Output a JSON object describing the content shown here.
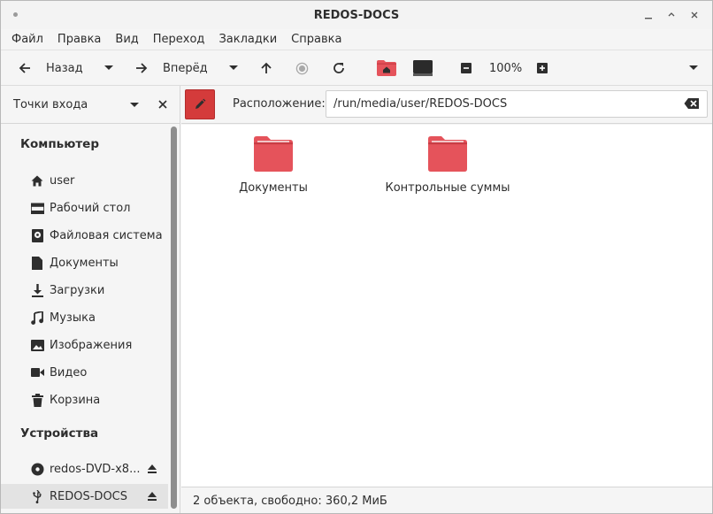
{
  "window": {
    "title": "REDOS-DOCS"
  },
  "menu": [
    "Файл",
    "Правка",
    "Вид",
    "Переход",
    "Закладки",
    "Справка"
  ],
  "toolbar": {
    "back_label": "Назад",
    "forward_label": "Вперёд",
    "zoom": "100%"
  },
  "sidebar": {
    "header": "Точки входа",
    "computer_section": "Компьютер",
    "computer_items": [
      {
        "label": "user",
        "icon": "home-icon"
      },
      {
        "label": "Рабочий стол",
        "icon": "desktop-icon"
      },
      {
        "label": "Файловая система",
        "icon": "drive-icon"
      },
      {
        "label": "Документы",
        "icon": "document-icon"
      },
      {
        "label": "Загрузки",
        "icon": "download-icon"
      },
      {
        "label": "Музыка",
        "icon": "music-icon"
      },
      {
        "label": "Изображения",
        "icon": "image-icon"
      },
      {
        "label": "Видео",
        "icon": "video-icon"
      },
      {
        "label": "Корзина",
        "icon": "trash-icon"
      }
    ],
    "devices_section": "Устройства",
    "device_items": [
      {
        "label": "redos-DVD-x8...",
        "icon": "optical-disc-icon"
      },
      {
        "label": "REDOS-DOCS",
        "icon": "usb-icon",
        "selected": true
      }
    ]
  },
  "location": {
    "label": "Расположение:",
    "path": "/run/media/user/REDOS-DOCS"
  },
  "files": [
    {
      "name": "Документы"
    },
    {
      "name": "Контрольные суммы"
    }
  ],
  "status": "2 объекта, свободно: 360,2 МиБ",
  "colors": {
    "folder": "#e5535b",
    "folder_tab": "#c93c44",
    "accent": "#d43b3b"
  }
}
